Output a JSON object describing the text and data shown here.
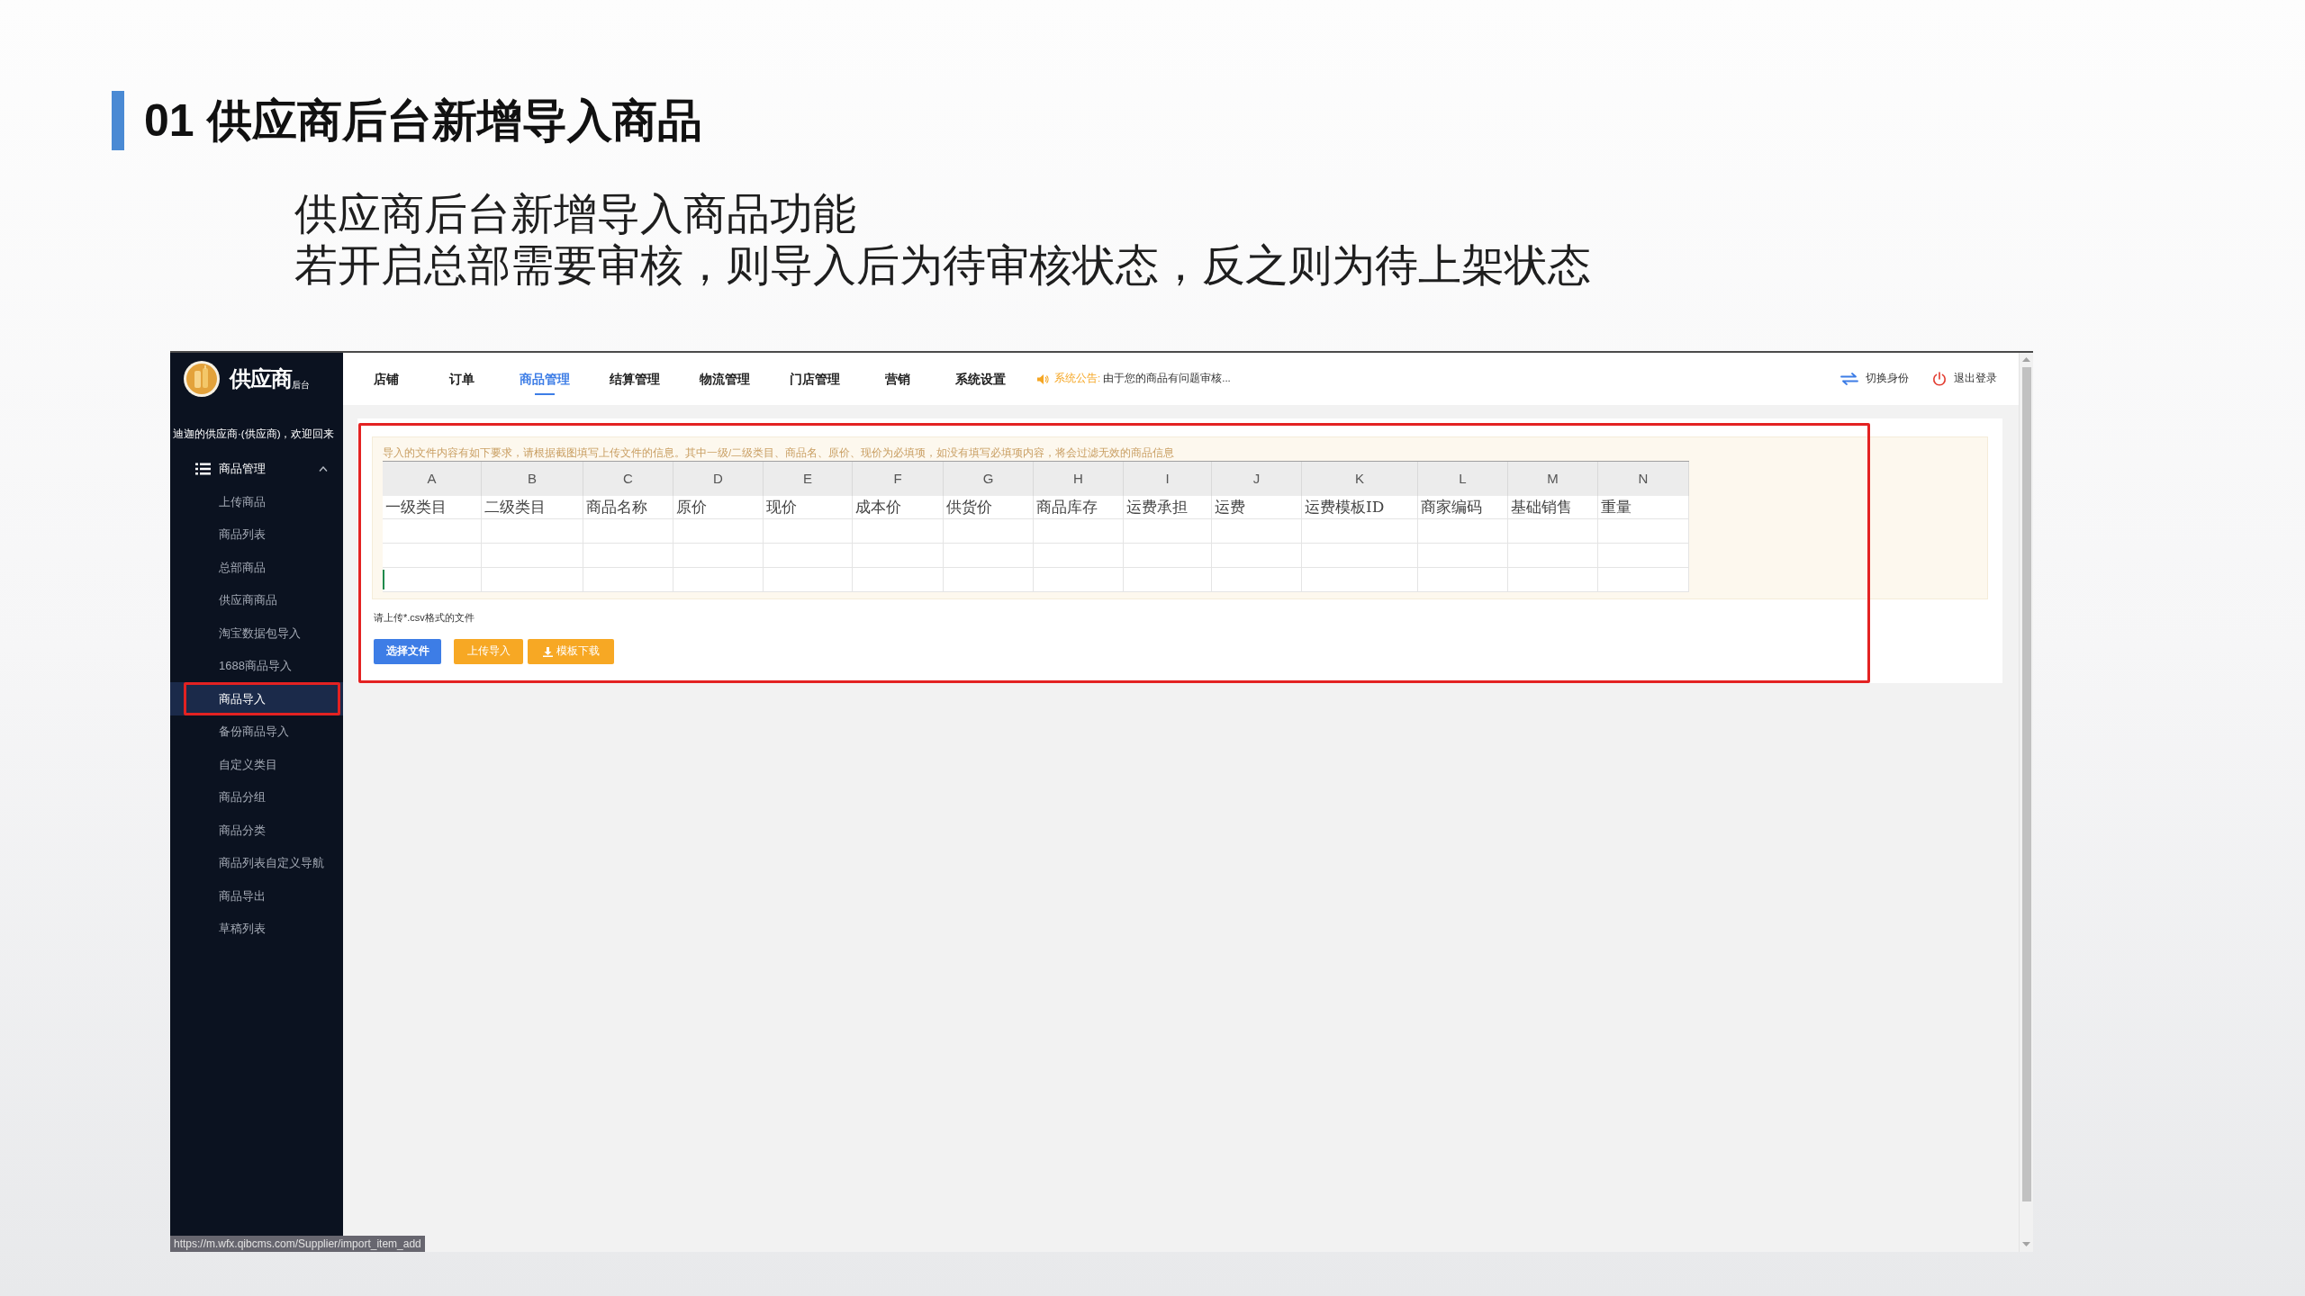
{
  "slide": {
    "title": "01 供应商后台新增导入商品",
    "description": [
      "供应商后台新增导入商品功能",
      "若开启总部需要审核，则导入后为待审核状态，反之则为待上架状态"
    ]
  },
  "app": {
    "logo": {
      "name": "供应商",
      "suffix": "后台"
    },
    "top_nav": [
      {
        "label": "店铺",
        "selected": false
      },
      {
        "label": "订单",
        "selected": false
      },
      {
        "label": "商品管理",
        "selected": true
      },
      {
        "label": "结算管理",
        "selected": false
      },
      {
        "label": "物流管理",
        "selected": false
      },
      {
        "label": "门店管理",
        "selected": false
      },
      {
        "label": "营销",
        "selected": false
      },
      {
        "label": "系统设置",
        "selected": false
      }
    ],
    "notice": {
      "label": "系统公告:",
      "text": "由于您的商品有问题审核..."
    },
    "user_actions": [
      {
        "kind": "switch",
        "label": "切换身份"
      },
      {
        "kind": "logout",
        "label": "退出登录"
      }
    ],
    "sidebar": {
      "welcome": "迪迦的供应商·(供应商)，欢迎回来",
      "group": {
        "label": "商品管理",
        "expanded": true,
        "items": [
          {
            "label": "上传商品",
            "selected": false,
            "highlighted": false
          },
          {
            "label": "商品列表",
            "selected": false,
            "highlighted": false
          },
          {
            "label": "总部商品",
            "selected": false,
            "highlighted": false
          },
          {
            "label": "供应商商品",
            "selected": false,
            "highlighted": false
          },
          {
            "label": "淘宝数据包导入",
            "selected": false,
            "highlighted": false
          },
          {
            "label": "1688商品导入",
            "selected": false,
            "highlighted": false
          },
          {
            "label": "商品导入",
            "selected": true,
            "highlighted": true
          },
          {
            "label": "备份商品导入",
            "selected": false,
            "highlighted": false
          },
          {
            "label": "自定义类目",
            "selected": false,
            "highlighted": false
          },
          {
            "label": "商品分组",
            "selected": false,
            "highlighted": false
          },
          {
            "label": "商品分类",
            "selected": false,
            "highlighted": false
          },
          {
            "label": "商品列表自定义导航",
            "selected": false,
            "highlighted": false
          },
          {
            "label": "商品导出",
            "selected": false,
            "highlighted": false
          },
          {
            "label": "草稿列表",
            "selected": false,
            "highlighted": false
          }
        ]
      }
    },
    "import_panel": {
      "highlighted": true,
      "requirements": "导入的文件内容有如下要求，请根据截图填写上传文件的信息。其中一级/二级类目、商品名、原价、现价为必填项，如没有填写必填项内容，将会过滤无效的商品信息",
      "sheet": {
        "columns": [
          {
            "letter": "A",
            "field": "一级类目"
          },
          {
            "letter": "B",
            "field": "二级类目"
          },
          {
            "letter": "C",
            "field": "商品名称"
          },
          {
            "letter": "D",
            "field": "原价"
          },
          {
            "letter": "E",
            "field": "现价"
          },
          {
            "letter": "F",
            "field": "成本价"
          },
          {
            "letter": "G",
            "field": "供货价"
          },
          {
            "letter": "H",
            "field": "商品库存"
          },
          {
            "letter": "I",
            "field": "运费承担"
          },
          {
            "letter": "J",
            "field": "运费"
          },
          {
            "letter": "K",
            "field": "运费模板ID"
          },
          {
            "letter": "L",
            "field": "商家编码"
          },
          {
            "letter": "M",
            "field": "基础销售"
          },
          {
            "letter": "N",
            "field": "重量"
          }
        ]
      },
      "hint": "请上传*.csv格式的文件",
      "buttons": [
        {
          "kind": "primary",
          "label": "选择文件"
        },
        {
          "kind": "warning",
          "label": "上传导入"
        },
        {
          "kind": "download",
          "label": "模板下载"
        }
      ]
    },
    "status_url": "https://m.wfx.qibcms.com/Supplier/import_item_add"
  }
}
